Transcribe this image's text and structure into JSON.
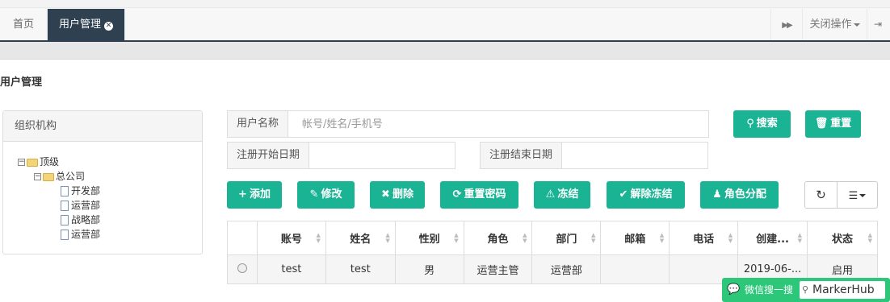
{
  "tabs": {
    "home": "首页",
    "active": "用户管理",
    "close_op": "关闭操作",
    "trailing": "ì"
  },
  "page_title": "用户管理",
  "org_panel": {
    "title": "组织机构",
    "tree": [
      {
        "label": "顶级",
        "kind": "folder",
        "level": 0
      },
      {
        "label": "总公司",
        "kind": "folder",
        "level": 1
      },
      {
        "label": "开发部",
        "kind": "doc",
        "level": 2
      },
      {
        "label": "运营部",
        "kind": "doc",
        "level": 2
      },
      {
        "label": "战略部",
        "kind": "doc",
        "level": 2
      },
      {
        "label": "运营部",
        "kind": "doc",
        "level": 2
      }
    ]
  },
  "search": {
    "username_label": "用户名称",
    "username_placeholder": "帐号/姓名/手机号",
    "start_label": "注册开始日期",
    "end_label": "注册结束日期",
    "search_btn": "搜索",
    "reset_btn": "重置"
  },
  "toolbar": {
    "add": "添加",
    "edit": "修改",
    "delete": "删除",
    "reset_pwd": "重置密码",
    "freeze": "冻结",
    "unfreeze": "解除冻结",
    "assign_role": "角色分配"
  },
  "table": {
    "headers": [
      "账号",
      "姓名",
      "性别",
      "角色",
      "部门",
      "邮箱",
      "电话",
      "创建...",
      "状态"
    ],
    "rows": [
      [
        "test",
        "test",
        "男",
        "运营主管",
        "运营部",
        "",
        "",
        "2019-06-...",
        "启用"
      ]
    ]
  },
  "watermark": {
    "text": "微信搜一搜",
    "brand": "MarkerHub"
  },
  "colors": {
    "accent": "#1ab394",
    "active_tab": "#2f4050"
  }
}
